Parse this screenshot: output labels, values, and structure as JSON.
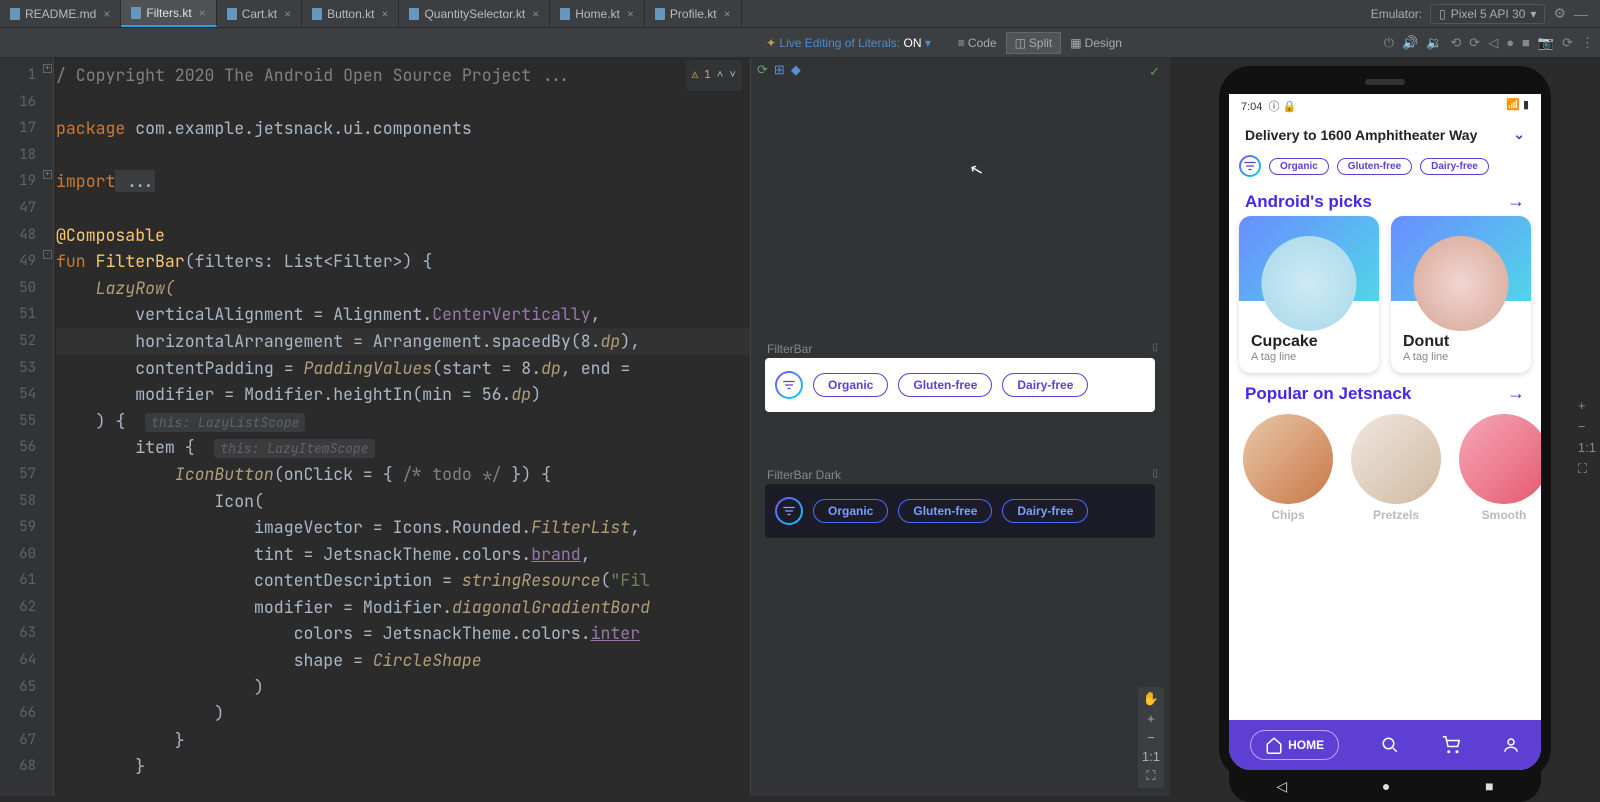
{
  "tabs": [
    {
      "name": "README.md"
    },
    {
      "name": "Filters.kt"
    },
    {
      "name": "Cart.kt"
    },
    {
      "name": "Button.kt"
    },
    {
      "name": "QuantitySelector.kt"
    },
    {
      "name": "Home.kt"
    },
    {
      "name": "Profile.kt"
    }
  ],
  "emulator": {
    "label": "Emulator:",
    "device": "Pixel 5 API 30"
  },
  "toolbar": {
    "literal_prefix": "Live Editing of Literals:",
    "literal_state": "ON",
    "views": {
      "code": "Code",
      "split": "Split",
      "design": "Design"
    }
  },
  "gutter": [
    "1",
    "16",
    "17",
    "18",
    "19",
    "47",
    "48",
    "49",
    "50",
    "51",
    "52",
    "53",
    "54",
    "55",
    "56",
    "57",
    "58",
    "59",
    "60",
    "61",
    "62",
    "63",
    "64",
    "65",
    "66",
    "67",
    "68"
  ],
  "code": {
    "copyright": "/ Copyright 2020 The Android Open Source Project ...",
    "package_kw": "package",
    "package": " com.example.jetsnack.ui.components",
    "import_kw": "import",
    "import_rest": " ...",
    "anno": "@Composable",
    "fun": "fun ",
    "fname": "FilterBar",
    "sig": "(filters: List<Filter>) {",
    "lazy": "    LazyRow(",
    "va": "        verticalAlignment = Alignment.",
    "va2": "CenterVertically",
    "va3": ",",
    "ha": "        horizontalArrangement = Arrangement.spacedBy(8.",
    "ha2": "dp",
    "ha3": "),",
    "cp": "        contentPadding = ",
    "cp2": "PaddingValues",
    "cp3": "(start = 8.",
    "cp4": "dp",
    "cp5": ", end = ",
    "mod": "        modifier = Modifier.heightIn(min = 56.",
    "mod2": "dp",
    "mod3": ")",
    "rb": "    ) {  ",
    "hint1": "this: LazyListScope",
    "item": "        item {  ",
    "hint2": "this: LazyItemScope",
    "ib": "            IconButton",
    "ib2": "(onClick = { ",
    "ib3": "/* todo */",
    "ib4": " }) {",
    "icon": "                Icon(",
    "iv": "                    imageVector = Icons.Rounded.",
    "iv2": "FilterList",
    "iv3": ",",
    "tint": "                    tint = JetsnackTheme.colors.",
    "tint2": "brand",
    "tint3": ",",
    "cd": "                    contentDescription = ",
    "cd2": "stringResource",
    "cd3": "(",
    "cd4": "\"Fil",
    "md": "                    modifier = Modifier.",
    "md2": "diagonalGradientBord",
    "col": "                        colors = JetsnackTheme.colors.",
    "col2": "inter",
    "shp": "                        shape = ",
    "shp2": "CircleShape",
    "c1": "                    )",
    "c2": "                )",
    "c3": "            }",
    "c4": "        }"
  },
  "inspection": {
    "warn": "1"
  },
  "preview": {
    "light_label": "FilterBar",
    "dark_label": "FilterBar Dark",
    "chips": [
      "Organic",
      "Gluten-free",
      "Dairy-free"
    ]
  },
  "zoom": {
    "fit": "1:1"
  },
  "app": {
    "time": "7:04",
    "delivery": "Delivery to 1600 Amphitheater Way",
    "section1": "Android's picks",
    "section2": "Popular on Jetsnack",
    "cards": [
      {
        "title": "Cupcake",
        "sub": "A tag line"
      },
      {
        "title": "Donut",
        "sub": "A tag line"
      }
    ],
    "circles": [
      "Chips",
      "Pretzels",
      "Smooth"
    ],
    "home": "HOME"
  }
}
